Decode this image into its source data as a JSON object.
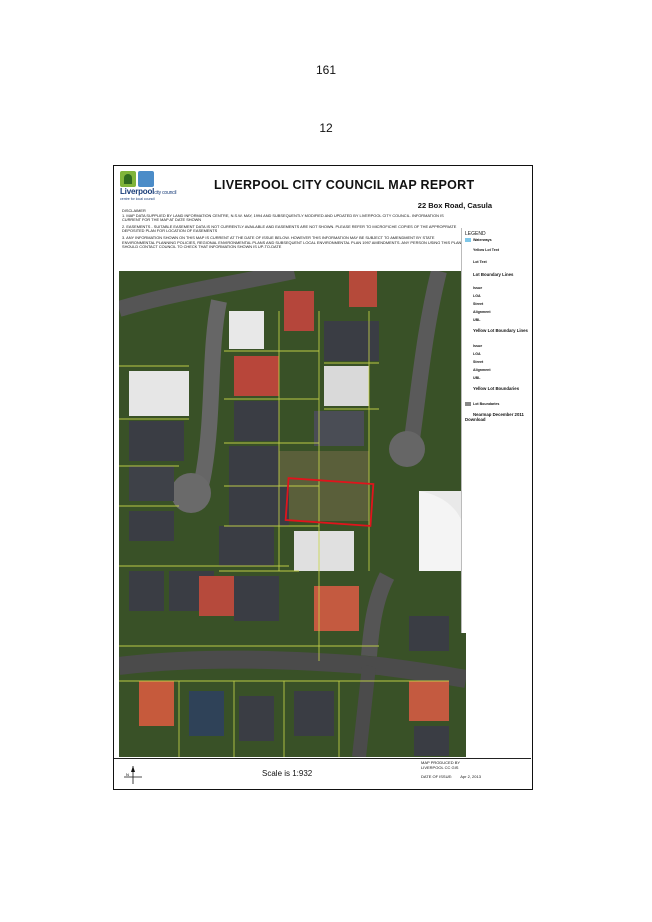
{
  "page_numbers": [
    "161",
    "12"
  ],
  "report": {
    "logo": {
      "word": "Liverpool",
      "suffix": "city council",
      "tagline": "centre for local council"
    },
    "title": "LIVERPOOL CITY COUNCIL MAP REPORT",
    "address": "22 Box Road, Casula",
    "disclaimer": [
      "DISCLAIMER\n1. MAP DATA SUPPLIED BY LAND INFORMATION CENTRE, N.S.W. MAY, 1994 AND SUBSEQUENTLY MODIFIED AND UPDATED BY LIVERPOOL CITY COUNCIL. INFORMATION IS CURRENT FOR THE MAP AT DATE SHOWN",
      "2. EASEMENTS - SUITABLE EASEMENT DATA IS NOT CURRENTLY AVAILABLE AND EASEMENTS ARE NOT SHOWN. PLEASE REFER TO MICROFICHE COPIES OF THE APPROPRIATE DEPOSITED PLAN FOR LOCATION OF EASEMENTS",
      "3. ANY INFORMATION SHOWN ON THIS MAP IS CURRENT AT THE DATE OF ISSUE BELOW. HOWEVER THIS INFORMATION MAY BE SUBJECT TO AMENDMENT BY STATE ENVIRONMENTAL PLANNING POLICIES, REGIONAL ENVIRONMENTAL PLANS AND SUBSEQUENT LOCAL ENVIRONMENTAL PLAN 1997 AMENDMENTS. ANY PERSON USING THIS PLAN SHOULD CONTACT COUNCIL TO CHECK THAT INFORMATION SHOWN IS UP-TO-DATE"
    ],
    "legend": {
      "title": "LEGEND",
      "items": [
        {
          "label": "Waterways",
          "color": "#7fc7e8"
        },
        {
          "label": "Yellow Lot Text",
          "color": ""
        },
        {
          "label": "Lot Text",
          "color": ""
        },
        {
          "label": "Lot Boundary Lines",
          "color": ""
        },
        {
          "label": "Issue",
          "color": ""
        },
        {
          "label": "LGA",
          "color": ""
        },
        {
          "label": "Street",
          "color": ""
        },
        {
          "label": "Alignment",
          "color": ""
        },
        {
          "label": "UBL",
          "color": ""
        },
        {
          "label": "Yellow Lot Boundary Lines",
          "color": ""
        },
        {
          "label": "Issue",
          "color": ""
        },
        {
          "label": "LGA",
          "color": ""
        },
        {
          "label": "Street",
          "color": ""
        },
        {
          "label": "Alignment",
          "color": ""
        },
        {
          "label": "UBL",
          "color": ""
        },
        {
          "label": "Yellow Lot Boundaries",
          "color": ""
        },
        {
          "label": "Lot Boundaries",
          "color": "#888888"
        },
        {
          "label": "Nearmap December 2011 Download",
          "color": ""
        }
      ]
    },
    "scale_text": "Scale is 1:932",
    "produced_by": "MAP PRODUCED BY\nLIVERPOOL CC GIS",
    "issue_label": "DATE OF ISSUE:",
    "issue_date": "Apr 2, 2013",
    "north_label": "N"
  },
  "colors": {
    "subject_lot": "#e0141c",
    "road": "#4a4a4a",
    "grass": "#3d5a26",
    "lot_line": "#c8d64a"
  }
}
